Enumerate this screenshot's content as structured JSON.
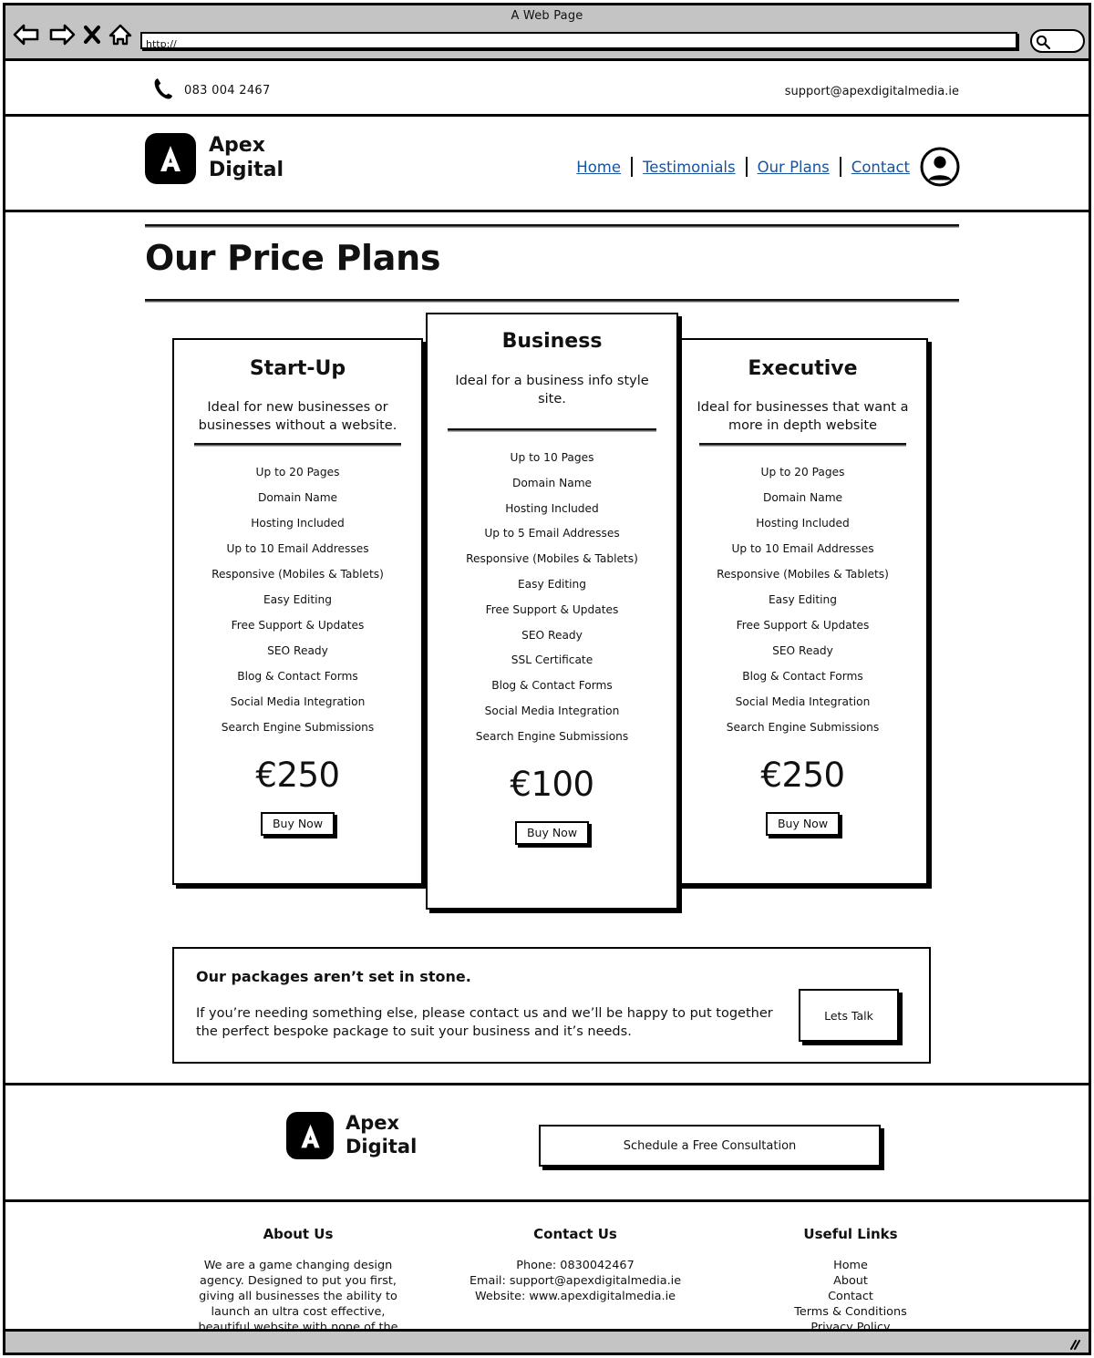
{
  "browser": {
    "window_title": "A Web Page",
    "url_value": "http://",
    "url_placeholder": "http://",
    "back_icon": "back-arrow-icon",
    "forward_icon": "forward-arrow-icon",
    "stop_icon": "close-x-icon",
    "home_icon": "home-icon",
    "search_icon": "search-icon"
  },
  "topbar": {
    "phone_icon": "phone-icon",
    "phone": "083 004 2467",
    "email": "support@apexdigitalmedia.ie"
  },
  "header": {
    "logo_letter": "A",
    "brand_line1": "Apex",
    "brand_line2": "Digital",
    "nav": [
      {
        "label": "Home"
      },
      {
        "label": "Testimonials"
      },
      {
        "label": "Our Plans"
      },
      {
        "label": "Contact"
      }
    ],
    "avatar_icon": "user-avatar-icon",
    "link_color": "#18539e"
  },
  "main": {
    "page_title": "Our Price Plans",
    "plans": [
      {
        "name": "Start-Up",
        "subtitle": "Ideal for new businesses or businesses without a website.",
        "features": [
          "Up to 20 Pages",
          "Domain Name",
          "Hosting Included",
          "Up to 10 Email Addresses",
          "Responsive (Mobiles & Tablets)",
          "Easy Editing",
          "Free Support & Updates",
          "SEO Ready",
          "Blog & Contact Forms",
          "Social Media Integration",
          "Search Engine Submissions"
        ],
        "price": "€250",
        "buy_label": "Buy Now"
      },
      {
        "name": "Business",
        "subtitle": "Ideal for a business info style site.",
        "features": [
          "Up to 10 Pages",
          "Domain Name",
          "Hosting Included",
          "Up to 5 Email Addresses",
          "Responsive (Mobiles & Tablets)",
          "Easy Editing",
          "Free Support & Updates",
          "SEO Ready",
          "SSL Certificate",
          "Blog & Contact Forms",
          "Social Media Integration",
          "Search Engine Submissions"
        ],
        "price": "€100",
        "buy_label": "Buy Now"
      },
      {
        "name": "Executive",
        "subtitle": "Ideal for businesses that want a more in depth website",
        "features": [
          "Up to 20 Pages",
          "Domain Name",
          "Hosting Included",
          "Up to 10 Email Addresses",
          "Responsive (Mobiles & Tablets)",
          "Easy Editing",
          "Free Support & Updates",
          "SEO Ready",
          "Blog & Contact Forms",
          "Social Media Integration",
          "Search Engine Submissions"
        ],
        "price": "€250",
        "buy_label": "Buy Now"
      }
    ],
    "bespoke": {
      "heading": "Our packages aren’t set in stone.",
      "body": "If you’re needing something else, please contact us and we’ll be happy to put together the perfect bespoke package to suit your business and it’s needs.",
      "button_label": "Lets Talk"
    }
  },
  "footer_cta": {
    "logo_letter": "A",
    "brand_line1": "Apex",
    "brand_line2": "Digital",
    "button_label": "Schedule a Free Consultation"
  },
  "footer": {
    "about": {
      "heading": "About Us",
      "text": "We are a game changing design agency. Designed to put you first, giving all businesses the ability to launch an ultra cost effective, beautiful website with none of the hassle."
    },
    "contact": {
      "heading": "Contact Us",
      "phone": "Phone: 0830042467",
      "email": "Email: support@apexdigitalmedia.ie",
      "website": "Website: www.apexdigitalmedia.ie"
    },
    "links": {
      "heading": "Useful Links",
      "items": [
        "Home",
        "About",
        "Contact",
        "Terms & Conditions",
        "Privacy Policy"
      ]
    }
  }
}
